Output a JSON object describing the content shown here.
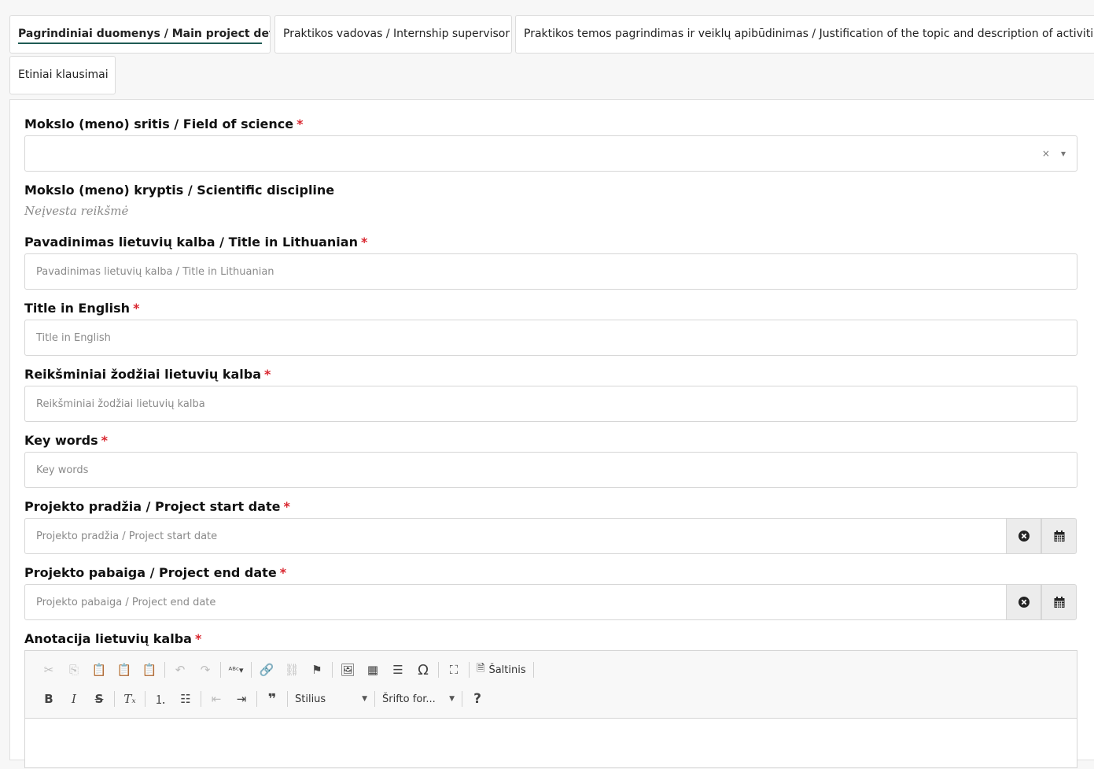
{
  "tabs": [
    {
      "label": "Pagrindiniai duomenys / Main project details",
      "active": true
    },
    {
      "label": "Praktikos vadovas / Internship supervisor",
      "active": false
    },
    {
      "label": "Praktikos temos pagrindimas ir veiklų apibūdinimas / Justification of the topic and description of activities",
      "active": false
    },
    {
      "label": "Etiniai klausimai",
      "active": false
    }
  ],
  "form": {
    "field_of_science": {
      "label": "Mokslo (meno) sritis / Field of science",
      "required": "*",
      "value": ""
    },
    "discipline": {
      "label": "Mokslo (meno) kryptis / Scientific discipline",
      "value": "Neįvesta reikšmė"
    },
    "title_lt": {
      "label": "Pavadinimas lietuvių kalba / Title in Lithuanian",
      "required": "*",
      "placeholder": "Pavadinimas lietuvių kalba / Title in Lithuanian"
    },
    "title_en": {
      "label": "Title in English",
      "required": "*",
      "placeholder": "Title in English"
    },
    "keywords_lt": {
      "label": "Reikšminiai žodžiai lietuvių kalba",
      "required": "*",
      "placeholder": "Reikšminiai žodžiai lietuvių kalba"
    },
    "keywords_en": {
      "label": "Key words",
      "required": "*",
      "placeholder": "Key words"
    },
    "start_date": {
      "label": "Projekto pradžia / Project start date",
      "required": "*",
      "placeholder": "Projekto pradžia / Project start date"
    },
    "end_date": {
      "label": "Projekto pabaiga / Project end date",
      "required": "*",
      "placeholder": "Projekto pabaiga / Project end date"
    },
    "annotation_lt": {
      "label": "Anotacija lietuvių kalba",
      "required": "*"
    }
  },
  "editor": {
    "source_label": "Šaltinis",
    "style_label": "Stilius",
    "font_label": "Šrifto for...",
    "help_label": "?",
    "bold_label": "B",
    "italic_label": "I",
    "strike_label": "S",
    "omega_label": "Ω",
    "quote_label": "❞"
  },
  "icons": {
    "select_clear": "×",
    "select_caret": "▾"
  },
  "colors": {
    "required": "#d9262f",
    "tab_underline": "#1f5b54"
  }
}
